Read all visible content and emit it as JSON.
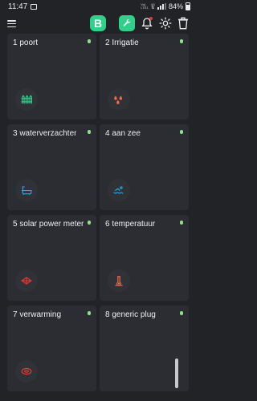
{
  "status_bar": {
    "time": "11:47",
    "network_top": "Vo)",
    "network_mid": "LTE1",
    "network_bottom": "4G",
    "battery": "84%"
  },
  "header": {
    "logo_letter": "B",
    "menu_icon": "hamburger-menu-icon",
    "wrench_icon": "wrench-icon",
    "bell_icon": "bell-icon",
    "sun_icon": "brightness-icon",
    "trash_icon": "trash-icon"
  },
  "colors": {
    "background": "#212327",
    "tile": "#2b2d33",
    "accent": "#2fd08a",
    "online_dot": "#8be28a",
    "notification": "#e53935"
  },
  "tiles": [
    {
      "label": "1 poort",
      "icon": "fence-icon",
      "icon_color": "#2fd08a"
    },
    {
      "label": "2 Irrigatie",
      "icon": "sprinkler-icon",
      "icon_color": "#f06a4a"
    },
    {
      "label": "3 waterverzachter",
      "icon": "water-softener-icon",
      "icon_color": "#29a8e0"
    },
    {
      "label": "4 aan zee",
      "icon": "swimming-icon",
      "icon_color": "#29a8e0"
    },
    {
      "label": "5 solar power meter",
      "icon": "solar-panel-icon",
      "icon_color": "#e53935"
    },
    {
      "label": "6 temperatuur",
      "icon": "thermometer-icon",
      "icon_color": "#f06a4a"
    },
    {
      "label": "7 verwarming",
      "icon": "heating-icon",
      "icon_color": "#e53935"
    },
    {
      "label": "8 generic plug",
      "icon": "plug-icon",
      "icon_color": "#e53935"
    }
  ]
}
